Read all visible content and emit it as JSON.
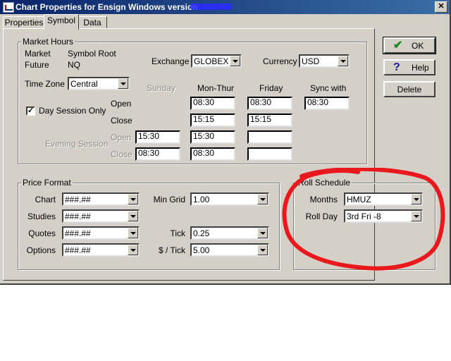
{
  "window": {
    "title": "Chart Properties for Ensign Windows version"
  },
  "tabs": [
    "Properties",
    "Symbol",
    "Data"
  ],
  "buttons": {
    "ok": "OK",
    "help": "Help",
    "delete": "Delete"
  },
  "market_hours": {
    "group_label": "Market Hours",
    "market_label": "Market",
    "market_value": "Symbol Root",
    "future_label": "Future",
    "future_value": "NQ",
    "exchange_label": "Exchange",
    "exchange_value": "GLOBEX",
    "currency_label": "Currency",
    "currency_value": "USD",
    "timezone_label": "Time Zone",
    "timezone_value": "Central",
    "col_sunday": "Sunday",
    "col_monthur": "Mon-Thur",
    "col_friday": "Friday",
    "col_sync": "Sync with",
    "day_session_label": "Day Session Only",
    "day_session_checked": true,
    "open_label": "Open",
    "close_label": "Close",
    "evening_label": "Evening Session",
    "evening_open_label": "Open",
    "evening_close_label": "Close",
    "open_monthur": "08:30",
    "open_friday": "08:30",
    "sync_value": "08:30",
    "close_monthur": "15:15",
    "close_friday": "15:15",
    "eve_open_sunday": "15:30",
    "eve_open_monthur": "15:30",
    "eve_open_friday": "",
    "eve_close_sunday": "08:30",
    "eve_close_monthur": "08:30",
    "eve_close_friday": ""
  },
  "price_format": {
    "group_label": "Price Format",
    "chart_label": "Chart",
    "chart_value": "###.##",
    "studies_label": "Studies",
    "studies_value": "###.##",
    "quotes_label": "Quotes",
    "quotes_value": "###.##",
    "options_label": "Options",
    "options_value": "###.##",
    "mingrid_label": "Min Grid",
    "mingrid_value": "1.00",
    "tick_label": "Tick",
    "tick_value": "0.25",
    "dollar_tick_label": "$ / Tick",
    "dollar_tick_value": "5.00"
  },
  "roll_schedule": {
    "group_label": "Roll Schedule",
    "months_label": "Months",
    "months_value": "HMUZ",
    "rollday_label": "Roll Day",
    "rollday_value": "3rd Fri -8"
  },
  "colors": {
    "annotation": "#e8181c",
    "titlebar": "#0a246a",
    "face": "#d4d0c8"
  }
}
